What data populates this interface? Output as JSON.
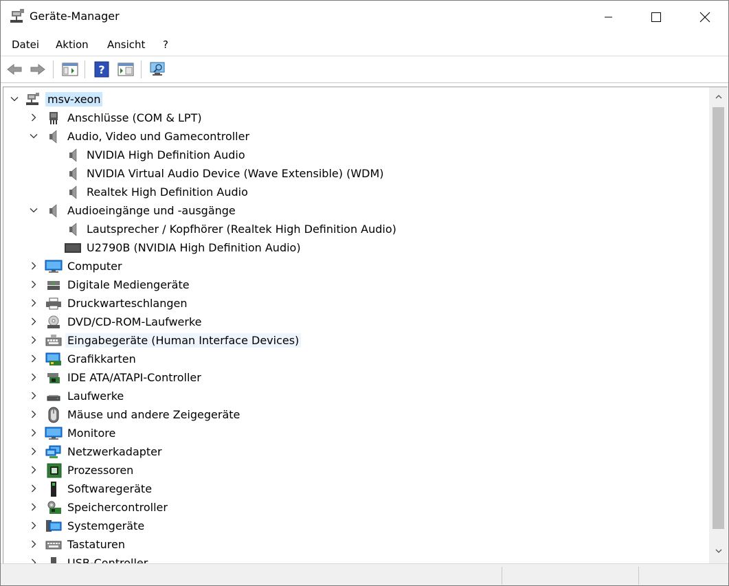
{
  "window": {
    "title": "Geräte-Manager",
    "icon": "device-manager-icon",
    "controls": [
      "minimize",
      "maximize",
      "close"
    ]
  },
  "menu": {
    "file": "Datei",
    "action": "Aktion",
    "view": "Ansicht",
    "help": "?"
  },
  "toolbar": {
    "buttons": [
      "back-icon",
      "forward-icon",
      "show-hide-console-tree-icon",
      "help-icon",
      "properties-icon",
      "scan-hardware-icon"
    ]
  },
  "tree": {
    "root": "msv-xeon",
    "nodes": [
      {
        "label": "Anschlüsse (COM & LPT)",
        "icon": "port-icon",
        "expanded": false
      },
      {
        "label": "Audio, Video und Gamecontroller",
        "icon": "speaker-icon",
        "expanded": true,
        "children": [
          {
            "label": "NVIDIA High Definition Audio",
            "icon": "speaker-icon"
          },
          {
            "label": "NVIDIA Virtual Audio Device (Wave Extensible) (WDM)",
            "icon": "speaker-icon"
          },
          {
            "label": "Realtek High Definition Audio",
            "icon": "speaker-icon"
          }
        ]
      },
      {
        "label": "Audioeingänge und -ausgänge",
        "icon": "speaker-icon",
        "expanded": true,
        "children": [
          {
            "label": "Lautsprecher / Kopfhörer (Realtek High Definition Audio)",
            "icon": "speaker-icon"
          },
          {
            "label": "U2790B (NVIDIA High Definition Audio)",
            "icon": "display-device-icon"
          }
        ]
      },
      {
        "label": "Computer",
        "icon": "computer-icon",
        "expanded": false
      },
      {
        "label": "Digitale Mediengeräte",
        "icon": "media-device-icon",
        "expanded": false
      },
      {
        "label": "Druckwarteschlangen",
        "icon": "printer-icon",
        "expanded": false
      },
      {
        "label": "DVD/CD-ROM-Laufwerke",
        "icon": "dvd-drive-icon",
        "expanded": false
      },
      {
        "label": "Eingabegeräte (Human Interface Devices)",
        "icon": "hid-icon",
        "expanded": false,
        "hover": true
      },
      {
        "label": "Grafikkarten",
        "icon": "graphics-card-icon",
        "expanded": false
      },
      {
        "label": "IDE ATA/ATAPI-Controller",
        "icon": "ide-controller-icon",
        "expanded": false
      },
      {
        "label": "Laufwerke",
        "icon": "disk-drive-icon",
        "expanded": false
      },
      {
        "label": "Mäuse und andere Zeigegeräte",
        "icon": "mouse-icon",
        "expanded": false
      },
      {
        "label": "Monitore",
        "icon": "monitor-icon",
        "expanded": false
      },
      {
        "label": "Netzwerkadapter",
        "icon": "network-adapter-icon",
        "expanded": false
      },
      {
        "label": "Prozessoren",
        "icon": "processor-icon",
        "expanded": false
      },
      {
        "label": "Softwaregeräte",
        "icon": "software-device-icon",
        "expanded": false
      },
      {
        "label": "Speichercontroller",
        "icon": "storage-controller-icon",
        "expanded": false
      },
      {
        "label": "Systemgeräte",
        "icon": "system-device-icon",
        "expanded": false
      },
      {
        "label": "Tastaturen",
        "icon": "keyboard-icon",
        "expanded": false
      },
      {
        "label": "USB-Controller",
        "icon": "usb-icon",
        "expanded": false,
        "partially_visible": true
      }
    ]
  },
  "colors": {
    "selection": "#cce8ff",
    "hover": "#eef5fc",
    "scrollbar_thumb": "#c1c1c1"
  }
}
